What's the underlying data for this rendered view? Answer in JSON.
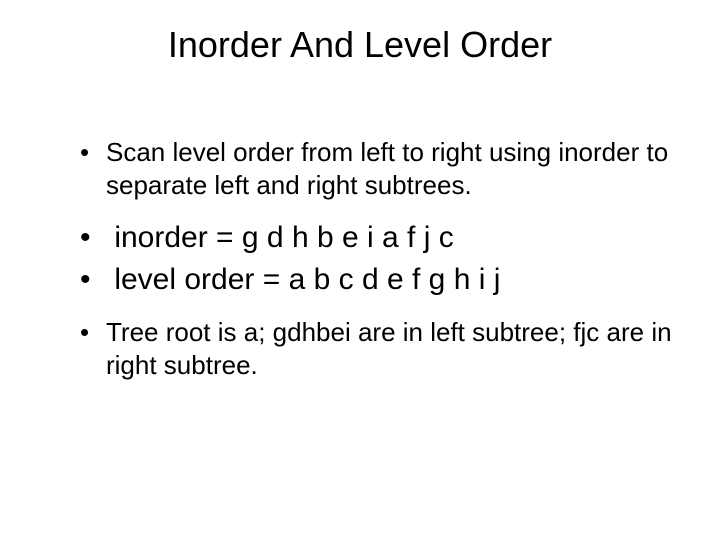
{
  "title": "Inorder And Level Order",
  "bullets": [
    {
      "size": "small",
      "text": "Scan level order from left to right using inorder to separate left and right subtrees."
    },
    {
      "size": "large",
      "text": " inorder = g d h b e i a f j c"
    },
    {
      "size": "large",
      "text": " level order = a b c d e f g h i j"
    },
    {
      "size": "small",
      "text": "Tree root is a; gdhbei are in left subtree; fjc are in right subtree."
    }
  ]
}
